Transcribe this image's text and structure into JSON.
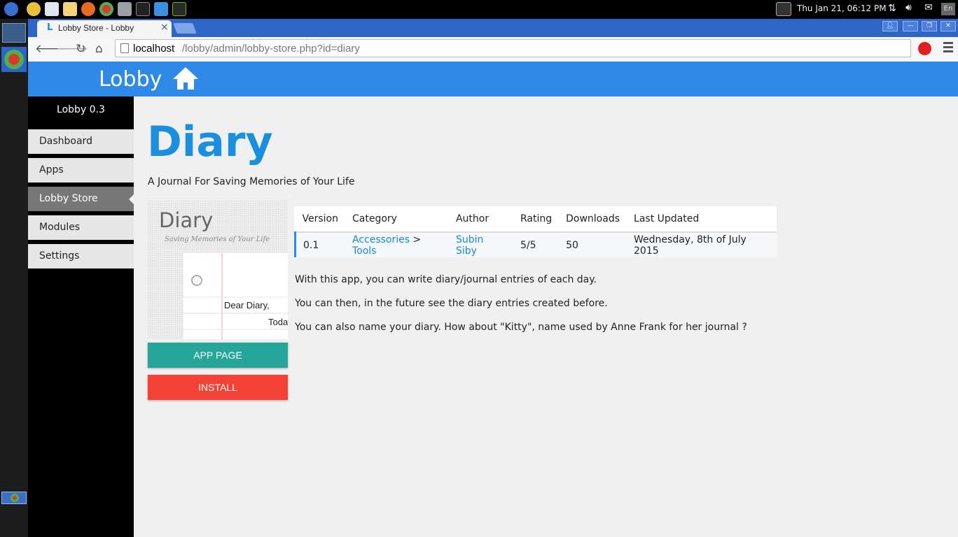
{
  "os": {
    "clock": "Thu Jan 21, 06:12 PM",
    "lang_indicator": "En"
  },
  "browser": {
    "tab_title": "Lobby Store - Lobby",
    "tab_favicon": "L",
    "tab_close": "×",
    "url_host": "localhost",
    "url_path": "/lobby/admin/lobby-store.php?id=diary"
  },
  "header": {
    "logo_text": "Lobby"
  },
  "sidebar": {
    "version": "Lobby 0.3",
    "items": [
      {
        "label": "Dashboard"
      },
      {
        "label": "Apps"
      },
      {
        "label": "Lobby Store"
      },
      {
        "label": "Modules"
      },
      {
        "label": "Settings"
      }
    ]
  },
  "app": {
    "title": "Diary",
    "subtitle": "A Journal For Saving Memories of Your Life",
    "image": {
      "title": "Diary",
      "tagline": "Saving Memories of Your Life",
      "line1": "Dear Diary,",
      "line2": "Toda"
    },
    "app_page_button": "APP PAGE",
    "install_button": "INSTALL"
  },
  "table": {
    "headers": [
      "Version",
      "Category",
      "Author",
      "Rating",
      "Downloads",
      "Last Updated"
    ],
    "row": {
      "version": "0.1",
      "category1": "Accessories",
      "category_sep": ">",
      "category2": "Tools",
      "author": "Subin Siby",
      "rating": "5/5",
      "downloads": "50",
      "last_updated": "Wednesday, 8th of July 2015"
    }
  },
  "description": [
    "With this app, you can write diary/journal entries of each day.",
    "You can then, in the future see the diary entries created before.",
    "You can also name your diary. How about \"Kitty\", name used by Anne Frank for her journal ?"
  ],
  "colors": {
    "header_blue": "#2e8ae6",
    "title_blue": "#1a8fe0",
    "app_page_teal": "#26a69a",
    "install_red": "#f44336"
  }
}
